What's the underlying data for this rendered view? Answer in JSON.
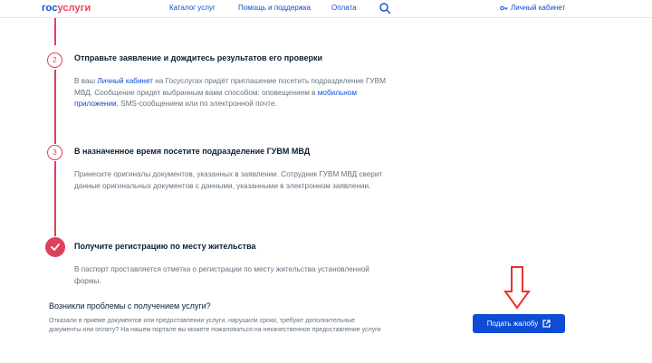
{
  "header": {
    "logo_part1": "гос",
    "logo_part2": "услуги",
    "nav": [
      {
        "label": "Каталог услуг"
      },
      {
        "label": "Помощь и поддержка"
      },
      {
        "label": "Оплата"
      }
    ],
    "search_icon": "search-icon",
    "cabinet_label": "Личный кабинет"
  },
  "steps": [
    {
      "number": "2",
      "title": "Отправьте заявление и дождитесь результатов его проверки",
      "text_1": "В ваш ",
      "link_1": "Личный кабинет",
      "text_2": " на Госуслугах придёт приглашение посетить подразделение ГУВМ МВД. Сообщение придет выбранным вами способом: оповещением в ",
      "link_2": "мобильном приложении",
      "text_3": ", SMS-сообщением или по электронной почте."
    },
    {
      "number": "3",
      "title": "В назначенное время посетите подразделение ГУВМ МВД",
      "text": "Принесите оригиналы документов, указанных в заявлении. Сотрудник ГУВМ МВД сверит данные оригинальных документов с данными, указанными в электронном заявлении."
    },
    {
      "icon": "check-icon",
      "title": "Получите регистрацию по месту жительства",
      "text": "В паспорт проставляется отметка о регистрации по месту жительства установленной формы."
    }
  ],
  "problems": {
    "title": "Возникли проблемы с получением услуги?",
    "text": "Отказали в приеме документов или предоставлении услуги, нарушили сроки, требуют дополнительные документы или оплату? На нашем портале вы можете пожаловаться на некачественное предоставление услуги"
  },
  "complaint_button": {
    "label": "Подать жалобу",
    "icon": "external-link-icon"
  },
  "colors": {
    "brand_blue": "#0d4cd3",
    "brand_red": "#ee3f58",
    "timeline_red": "#e03f5c",
    "annotation_red": "#e8322e"
  }
}
